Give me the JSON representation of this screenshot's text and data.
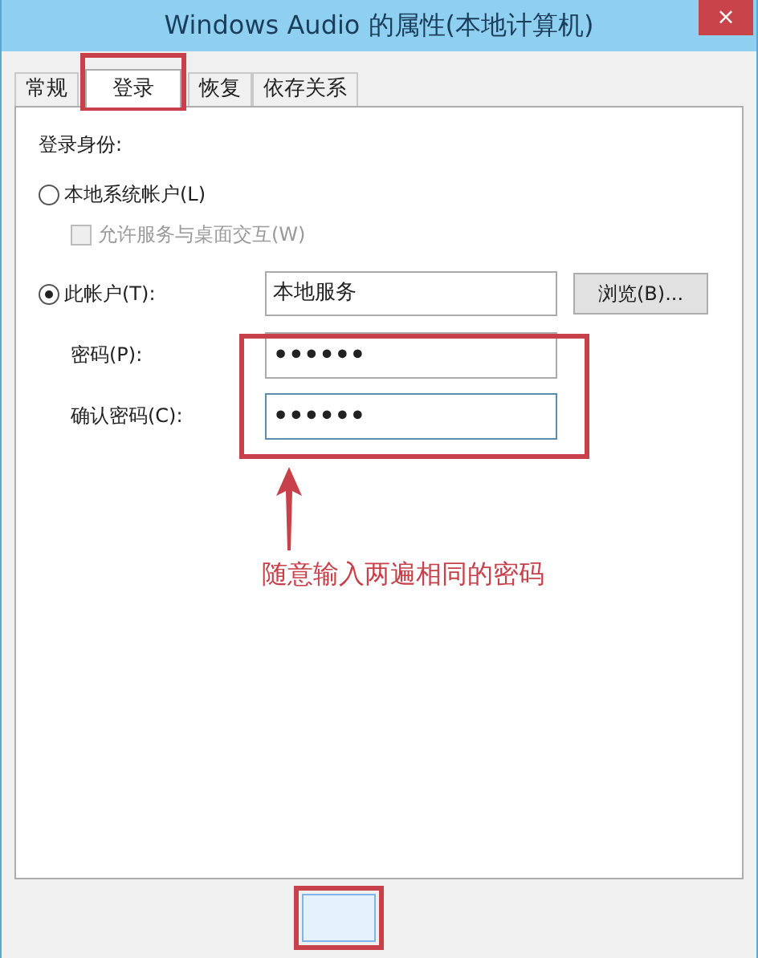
{
  "window": {
    "title": "Windows Audio 的属性(本地计算机)",
    "close": "×"
  },
  "tabs": [
    {
      "label": "常规",
      "selected": false
    },
    {
      "label": "登录",
      "selected": true
    },
    {
      "label": "恢复",
      "selected": false
    },
    {
      "label": "依存关系",
      "selected": false
    }
  ],
  "logon": {
    "heading": "登录身份:",
    "local_system": {
      "label": "本地系统帐户(L)",
      "selected": false
    },
    "interact": {
      "label": "允许服务与桌面交互(W)",
      "checked": false,
      "disabled": true
    },
    "this_account": {
      "label": "此帐户(T):",
      "selected": true,
      "value": "本地服务",
      "browse": "浏览(B)..."
    },
    "password": {
      "label": "密码(P):",
      "value": "••••••"
    },
    "confirm": {
      "label": "确认密码(C):",
      "value": "••••••"
    }
  },
  "annotation": {
    "text": "随意输入两遍相同的密码"
  }
}
